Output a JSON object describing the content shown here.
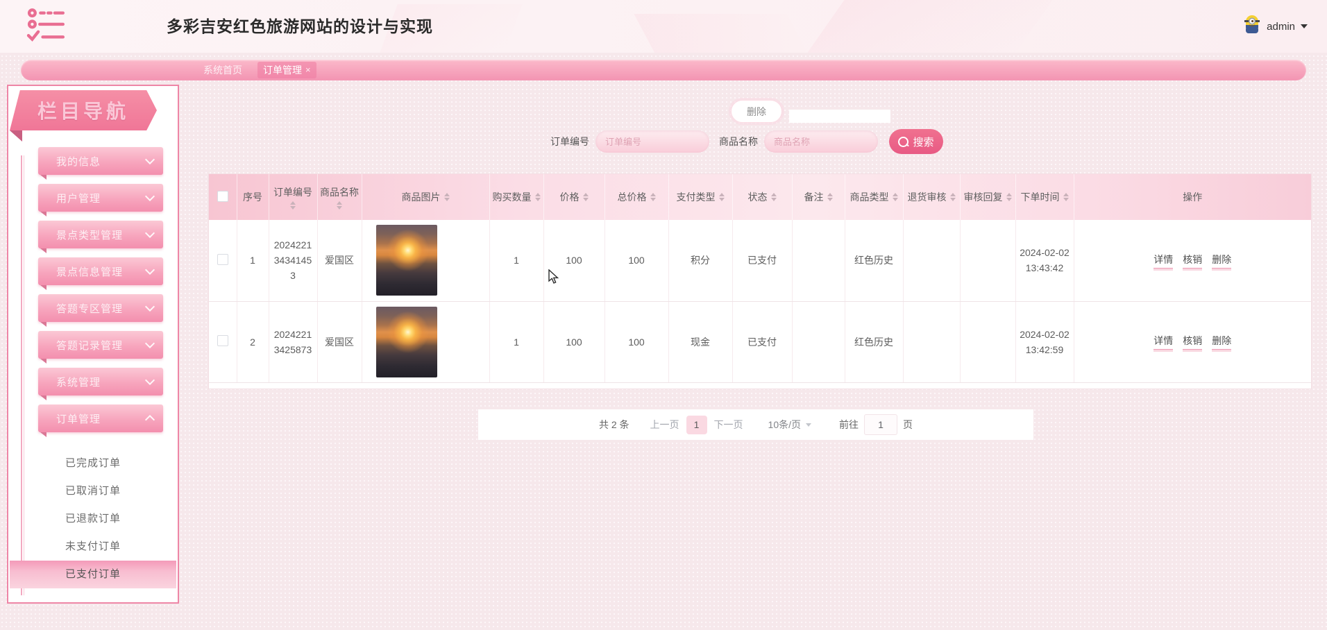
{
  "header": {
    "title": "多彩吉安红色旅游网站的设计与实现",
    "user": "admin"
  },
  "tabs": [
    {
      "label": "系统首页",
      "active": false,
      "closable": false
    },
    {
      "label": "订单管理",
      "active": true,
      "closable": true
    }
  ],
  "icons": {
    "logo": "checklist-icon",
    "avatar": "minion-avatar",
    "close_glyph": "×",
    "search": "magnifier-icon",
    "sort": "sort-arrows-icon",
    "chevron_down": "chevron-down-icon",
    "chevron_up": "chevron-up-icon",
    "cursor": "mouse-arrow-cursor",
    "product_image": "sunset-over-sea-photo"
  },
  "colors": {
    "accent_pink": "#f48fb1",
    "deep_pink": "#e85a84",
    "table_header_pink": "#f8ccd8",
    "menu_pink": "#f590ad",
    "text_dark": "#5c5c5c"
  },
  "sidebar": {
    "title": "栏目导航",
    "items": [
      {
        "label": "我的信息",
        "expanded": false
      },
      {
        "label": "用户管理",
        "expanded": false
      },
      {
        "label": "景点类型管理",
        "expanded": false
      },
      {
        "label": "景点信息管理",
        "expanded": false
      },
      {
        "label": "答题专区管理",
        "expanded": false
      },
      {
        "label": "答题记录管理",
        "expanded": false
      },
      {
        "label": "系统管理",
        "expanded": false
      },
      {
        "label": "订单管理",
        "expanded": true
      }
    ],
    "submenu": [
      {
        "label": "已完成订单",
        "active": false
      },
      {
        "label": "已取消订单",
        "active": false
      },
      {
        "label": "已退款订单",
        "active": false
      },
      {
        "label": "未支付订单",
        "active": false
      },
      {
        "label": "已支付订单",
        "active": true
      }
    ]
  },
  "toolbar": {
    "delete_label": "删除"
  },
  "search": {
    "order_no_label": "订单编号",
    "order_no_placeholder": "订单编号",
    "product_label": "商品名称",
    "product_placeholder": "商品名称",
    "search_label": "搜索"
  },
  "table": {
    "columns": [
      {
        "label": "",
        "type": "checkbox",
        "sortable": false
      },
      {
        "label": "序号",
        "sortable": false
      },
      {
        "label": "订单编号",
        "sortable": true
      },
      {
        "label": "商品名称",
        "sortable": true
      },
      {
        "label": "商品图片",
        "sortable": true
      },
      {
        "label": "购买数量",
        "sortable": true
      },
      {
        "label": "价格",
        "sortable": true
      },
      {
        "label": "总价格",
        "sortable": true
      },
      {
        "label": "支付类型",
        "sortable": true
      },
      {
        "label": "状态",
        "sortable": true
      },
      {
        "label": "备注",
        "sortable": true
      },
      {
        "label": "商品类型",
        "sortable": true
      },
      {
        "label": "退货审核",
        "sortable": true
      },
      {
        "label": "审核回复",
        "sortable": true
      },
      {
        "label": "下单时间",
        "sortable": true
      },
      {
        "label": "操作",
        "sortable": false
      }
    ],
    "rows": [
      {
        "index": "1",
        "order_no": "202422134341453",
        "product_name": "爱国区",
        "qty": "1",
        "price": "100",
        "total": "100",
        "pay_type": "积分",
        "status": "已支付",
        "note": "",
        "category": "红色历史",
        "refund_review": "",
        "review_reply": "",
        "time": "2024-02-02 13:43:42"
      },
      {
        "index": "2",
        "order_no": "20242213425873",
        "product_name": "爱国区",
        "qty": "1",
        "price": "100",
        "total": "100",
        "pay_type": "现金",
        "status": "已支付",
        "note": "",
        "category": "红色历史",
        "refund_review": "",
        "review_reply": "",
        "time": "2024-02-02 13:42:59"
      }
    ],
    "row_actions": [
      "详情",
      "核销",
      "删除"
    ]
  },
  "pagination": {
    "total": "共 2 条",
    "prev": "上一页",
    "page": "1",
    "next": "下一页",
    "page_size": "10条/页",
    "goto_label": "前往",
    "goto_value": "1",
    "goto_suffix": "页"
  }
}
